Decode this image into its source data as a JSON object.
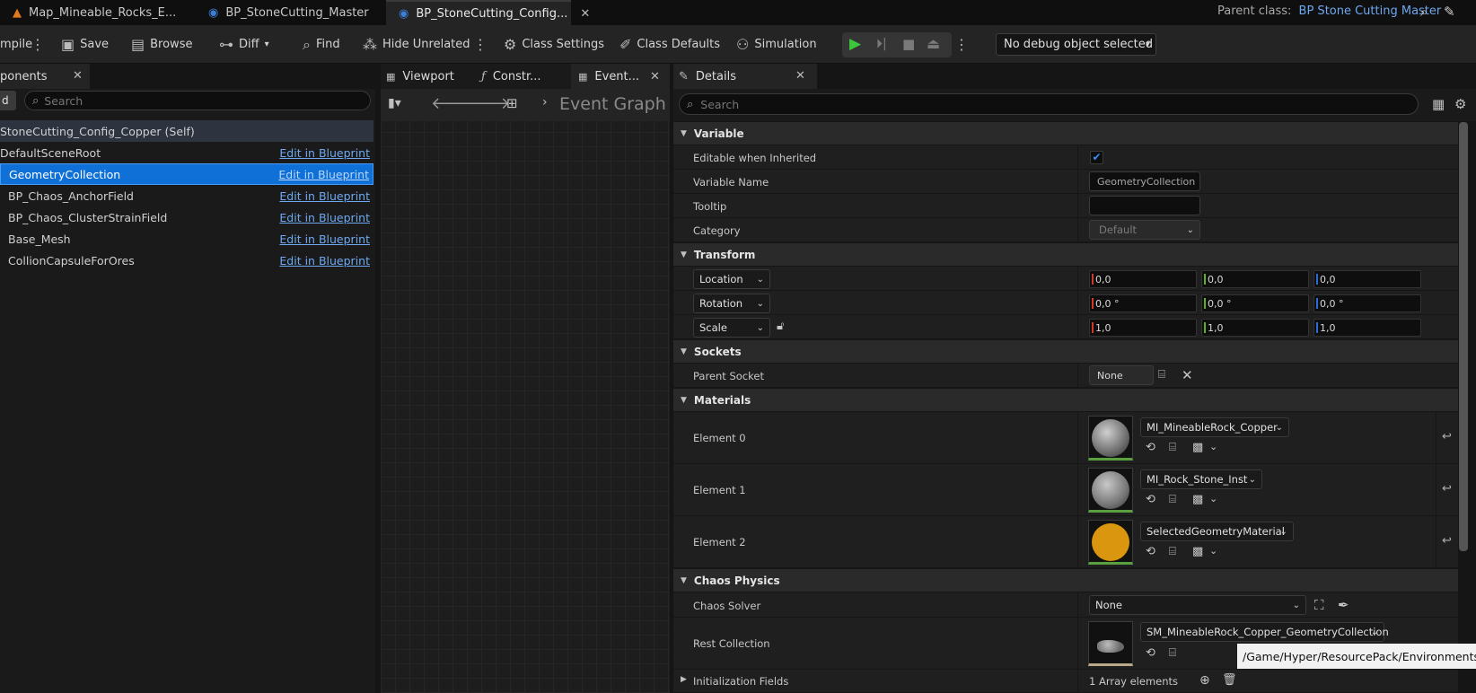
{
  "tabs": [
    {
      "label": "Map_Mineable_Rocks_E...",
      "icon": "map-icon"
    },
    {
      "label": "BP_StoneCutting_Master",
      "icon": "blueprint-icon"
    },
    {
      "label": "BP_StoneCutting_Config...",
      "icon": "blueprint-icon",
      "active": true
    }
  ],
  "parent_class": {
    "label": "Parent class:",
    "value": "BP Stone Cutting Master"
  },
  "toolbar": {
    "compile": "mpile",
    "save": "Save",
    "browse": "Browse",
    "diff": "Diff",
    "find": "Find",
    "hide_unrelated": "Hide Unrelated",
    "class_settings": "Class Settings",
    "class_defaults": "Class Defaults",
    "simulation": "Simulation",
    "debug_object": "No debug object selected"
  },
  "components": {
    "title": "ponents",
    "add": "d",
    "search_placeholder": "Search",
    "self_label": "StoneCutting_Config_Copper (Self)",
    "items": [
      {
        "name": "DefaultSceneRoot",
        "edit": "Edit in Blueprint"
      },
      {
        "name": "GeometryCollection",
        "edit": "Edit in Blueprint",
        "selected": true
      },
      {
        "name": "BP_Chaos_AnchorField",
        "edit": "Edit in Blueprint"
      },
      {
        "name": "BP_Chaos_ClusterStrainField",
        "edit": "Edit in Blueprint"
      },
      {
        "name": "Base_Mesh",
        "edit": "Edit in Blueprint"
      },
      {
        "name": "CollionCapsuleForOres",
        "edit": "Edit in Blueprint"
      }
    ]
  },
  "editor_tabs": {
    "viewport": "Viewport",
    "construction": "Constr...",
    "event": "Event..."
  },
  "graph": {
    "breadcrumb": "Event Graph"
  },
  "details": {
    "title": "Details",
    "search_placeholder": "Search",
    "variable": {
      "header": "Variable",
      "editable_label": "Editable when Inherited",
      "editable_checked": true,
      "name_label": "Variable Name",
      "name_value": "GeometryCollection",
      "tooltip_label": "Tooltip",
      "tooltip_value": "",
      "category_label": "Category",
      "category_value": "Default"
    },
    "transform": {
      "header": "Transform",
      "location_label": "Location",
      "location": [
        "0,0",
        "0,0",
        "0,0"
      ],
      "rotation_label": "Rotation",
      "rotation": [
        "0,0 °",
        "0,0 °",
        "0,0 °"
      ],
      "scale_label": "Scale",
      "scale": [
        "1,0",
        "1,0",
        "1,0"
      ]
    },
    "sockets": {
      "header": "Sockets",
      "parent_label": "Parent Socket",
      "parent_value": "None"
    },
    "materials": {
      "header": "Materials",
      "elements": [
        {
          "label": "Element 0",
          "value": "MI_MineableRock_Copper"
        },
        {
          "label": "Element 1",
          "value": "MI_Rock_Stone_Inst"
        },
        {
          "label": "Element 2",
          "value": "SelectedGeometryMaterial"
        }
      ]
    },
    "chaos": {
      "header": "Chaos Physics",
      "solver_label": "Chaos Solver",
      "solver_value": "None",
      "rest_label": "Rest Collection",
      "rest_value": "SM_MineableRock_Copper_GeometryCollection",
      "init_label": "Initialization Fields",
      "init_value": "1 Array elements"
    },
    "tooltip_path": "/Game/Hyper/ResourcePack/Environments/Roc"
  }
}
